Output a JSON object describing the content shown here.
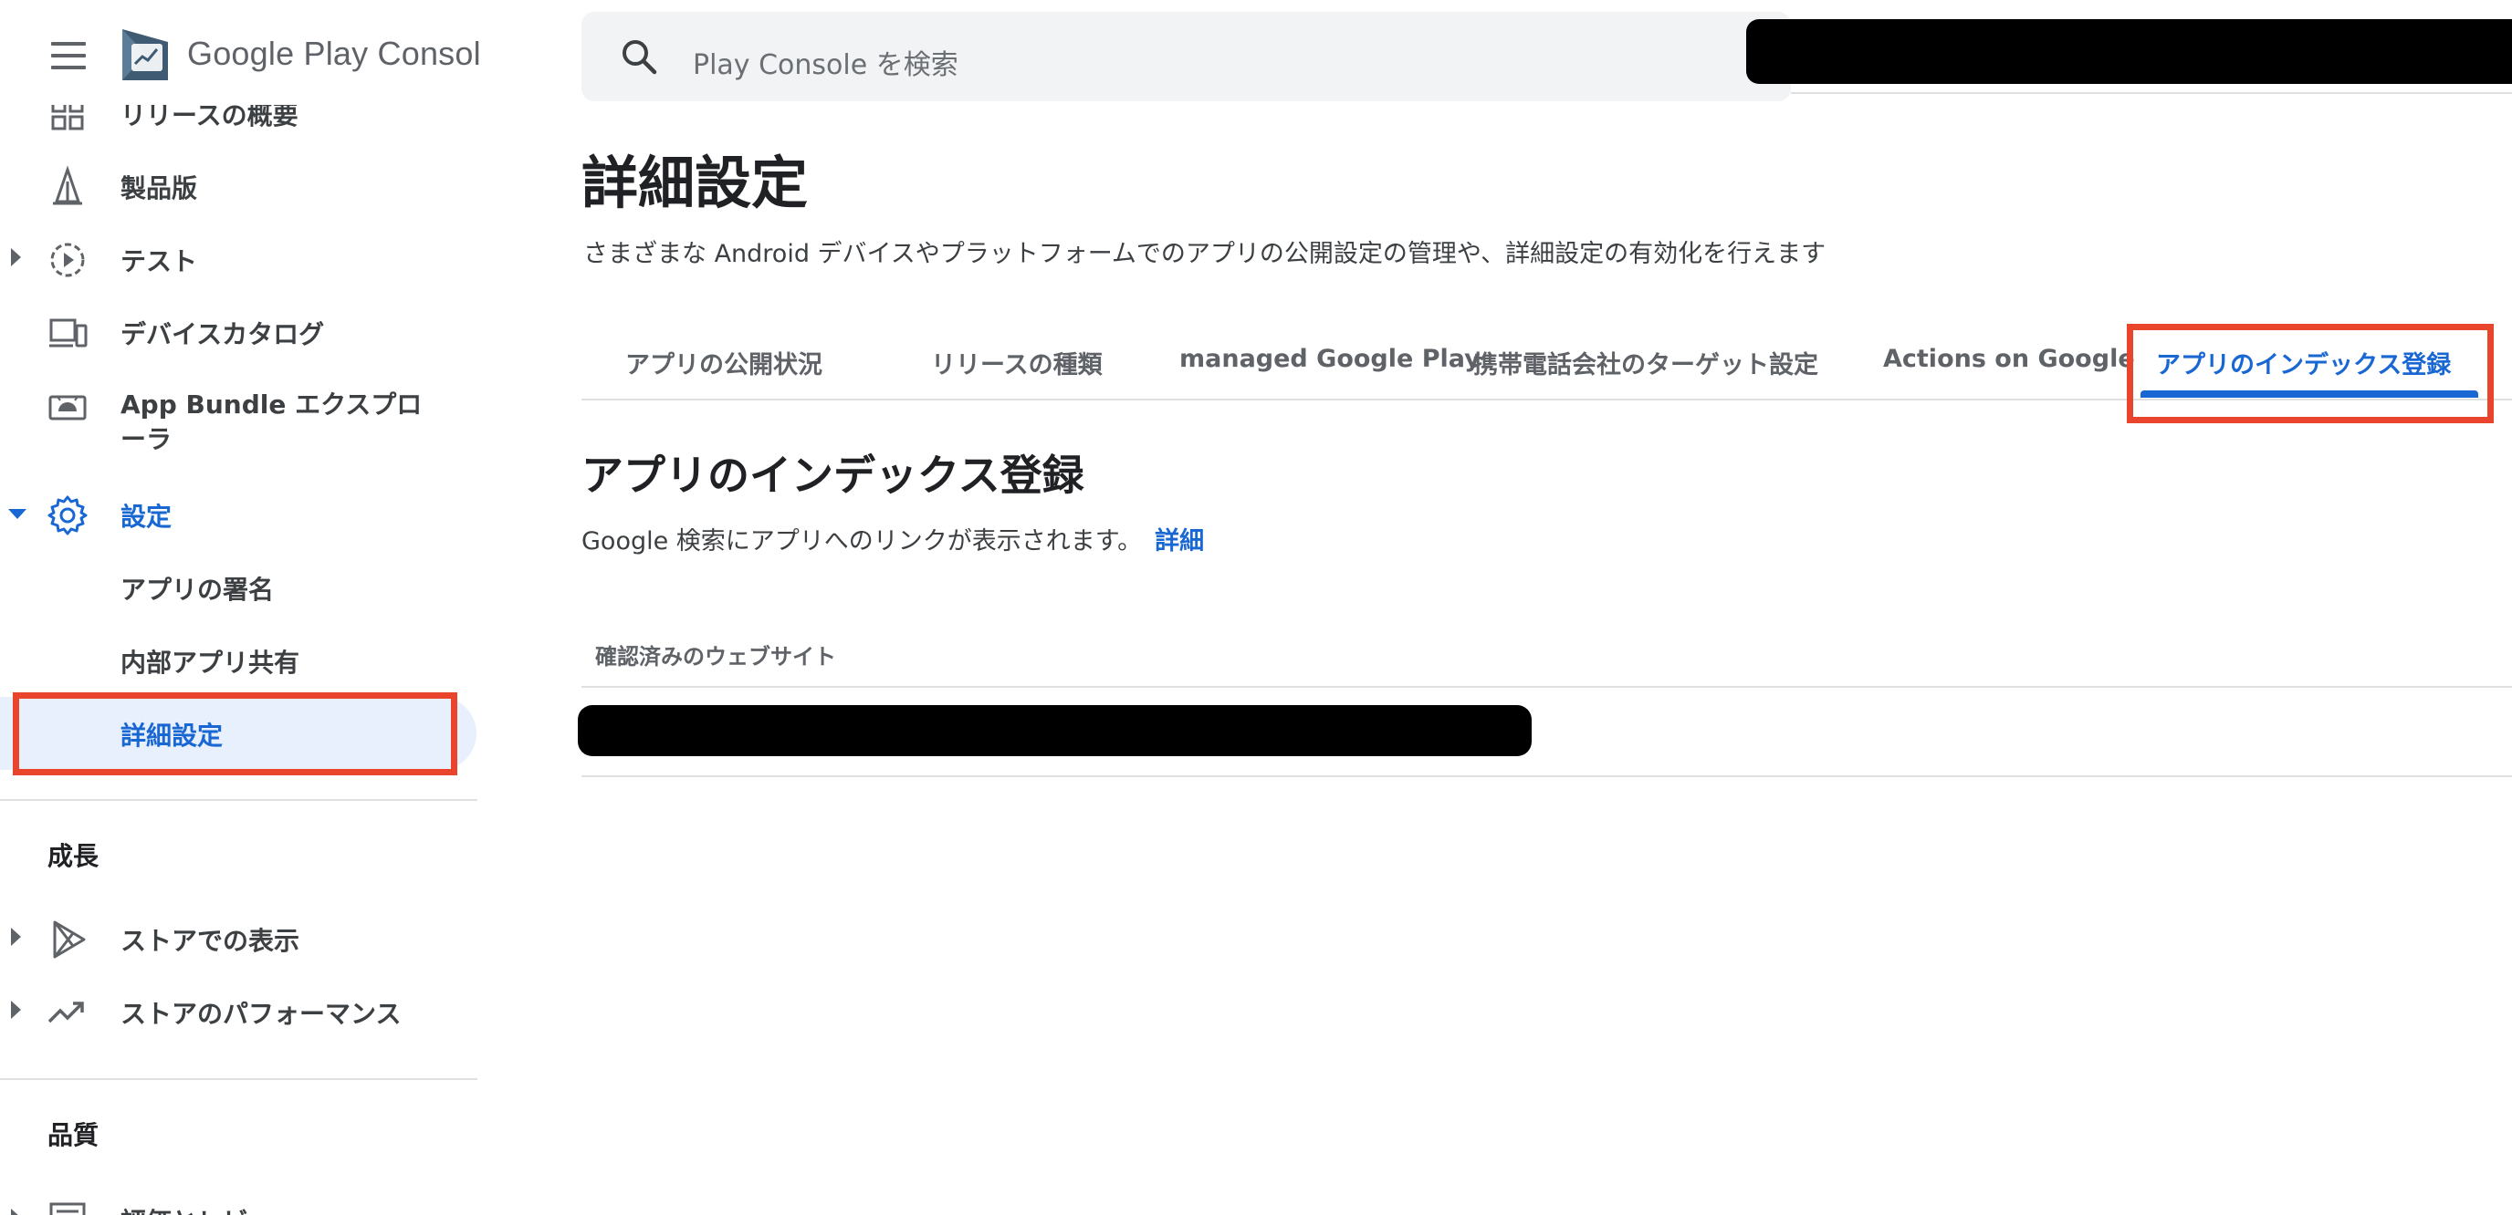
{
  "brand": {
    "google_play": "Google Play",
    "console": "Console"
  },
  "sidebar": {
    "items": [
      {
        "label": "リリースの概要",
        "icon": "dashboard-icon"
      },
      {
        "label": "製品版",
        "icon": "production-icon"
      },
      {
        "label": "テスト",
        "icon": "testing-icon"
      },
      {
        "label": "デバイスカタログ",
        "icon": "devices-icon"
      },
      {
        "label": "App Bundle エクスプローラ",
        "icon": "android-icon"
      },
      {
        "label": "設定",
        "icon": "gear-icon"
      },
      {
        "label": "アプリの署名"
      },
      {
        "label": "内部アプリ共有"
      },
      {
        "label": "詳細設定"
      }
    ],
    "section_growth": "成長",
    "growth_items": [
      {
        "label": "ストアでの表示",
        "icon": "play-store-icon"
      },
      {
        "label": "ストアのパフォーマンス",
        "icon": "trending-up-icon"
      }
    ],
    "section_quality": "品質",
    "quality_items": [
      {
        "label": "評価とレビュー",
        "icon": "reviews-icon"
      }
    ]
  },
  "search": {
    "placeholder": "Play Console を検索"
  },
  "main": {
    "title": "詳細設定",
    "description": "さまざまな Android デバイスやプラットフォームでのアプリの公開設定の管理や、詳細設定の有効化を行えます",
    "tabs": [
      {
        "label": "アプリの公開状況"
      },
      {
        "label": "リリースの種類"
      },
      {
        "label": "managed Google Play"
      },
      {
        "label": "携帯電話会社のターゲット設定"
      },
      {
        "label": "Actions on Google"
      },
      {
        "label": "アプリのインデックス登録"
      }
    ],
    "section_title": "アプリのインデックス登録",
    "section_description": "Google 検索にアプリへのリンクが表示されます。",
    "section_link": "詳細",
    "column_header": "確認済みのウェブサイト"
  },
  "colors": {
    "accent": "#1967d2",
    "highlight": "#e8452c",
    "selected_bg": "#e8f0fe"
  }
}
